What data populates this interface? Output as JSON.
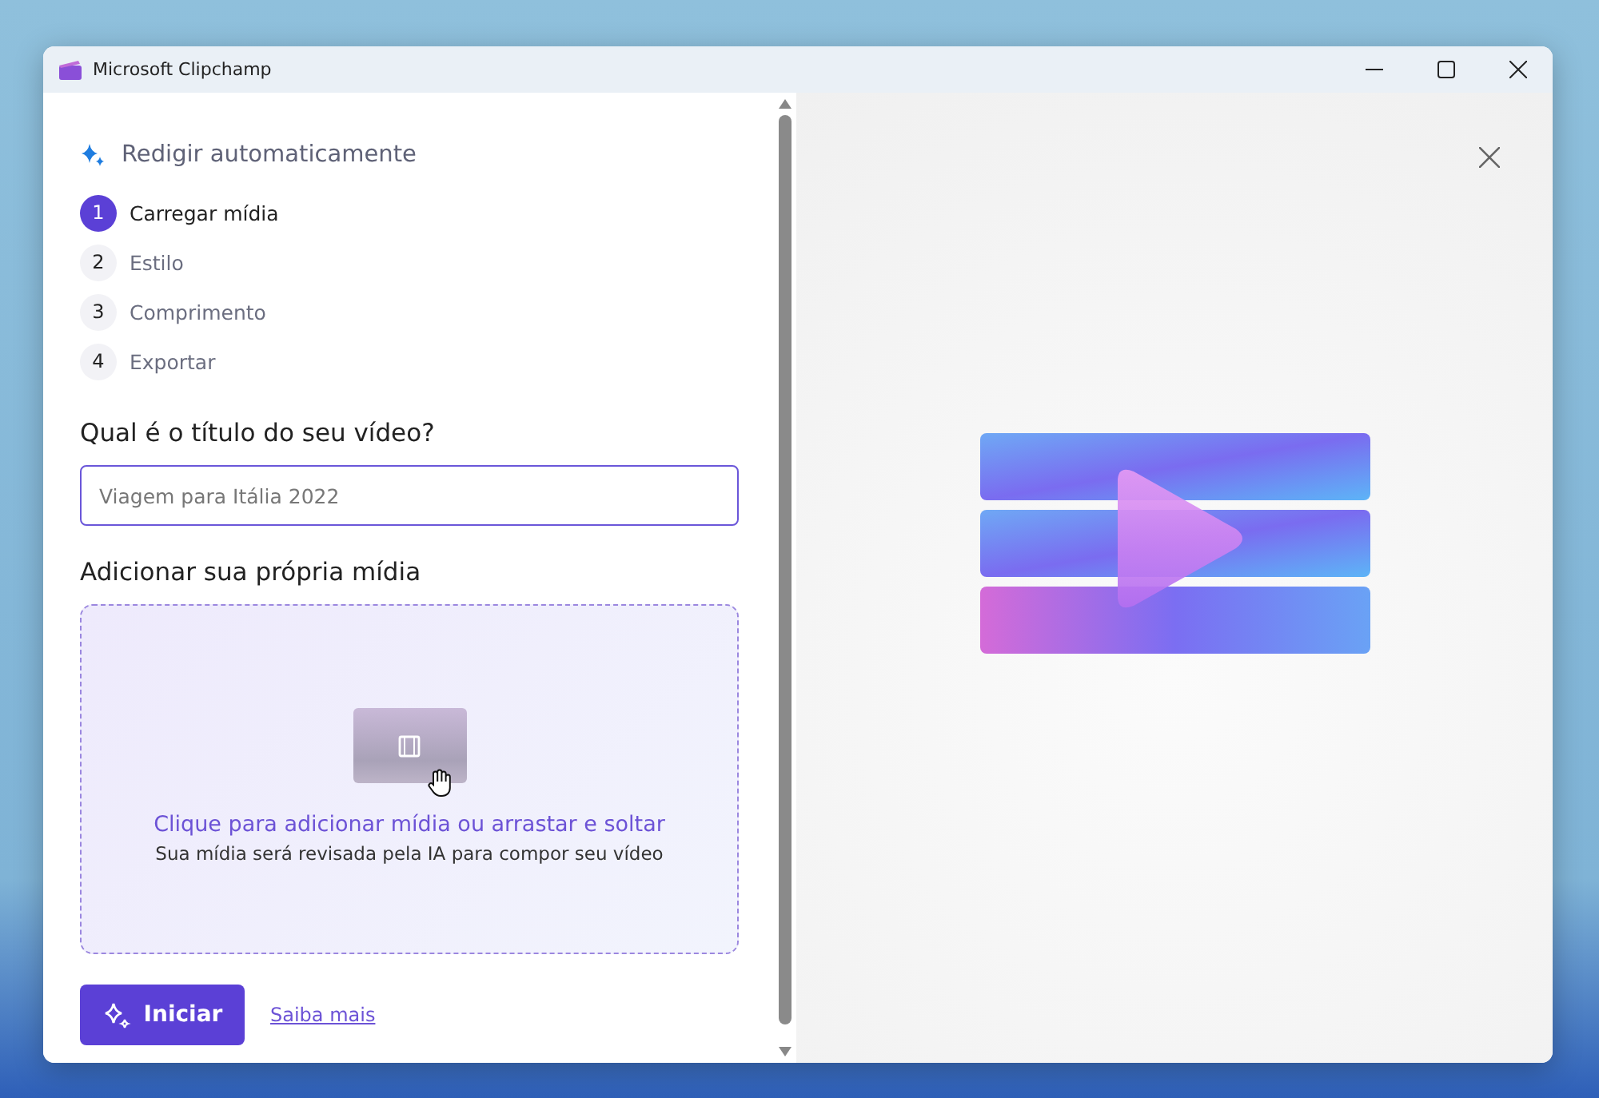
{
  "window": {
    "title": "Microsoft Clipchamp"
  },
  "panel": {
    "heading": "Redigir automaticamente",
    "steps": [
      {
        "number": "1",
        "label": "Carregar mídia",
        "selected": true
      },
      {
        "number": "2",
        "label": "Estilo",
        "selected": false
      },
      {
        "number": "3",
        "label": "Comprimento",
        "selected": false
      },
      {
        "number": "4",
        "label": "Exportar",
        "selected": false
      }
    ],
    "title_question": "Qual é o título do seu vídeo?",
    "title_field": {
      "placeholder": "Viagem para Itália 2022"
    },
    "media_heading": "Adicionar sua própria mídia",
    "dropzone": {
      "title": "Clique para adicionar mídia ou arrastar e soltar",
      "subtitle": "Sua mídia será revisada pela IA para compor seu vídeo"
    },
    "start_button": "Iniciar",
    "learn_more_link": "Saiba mais"
  }
}
